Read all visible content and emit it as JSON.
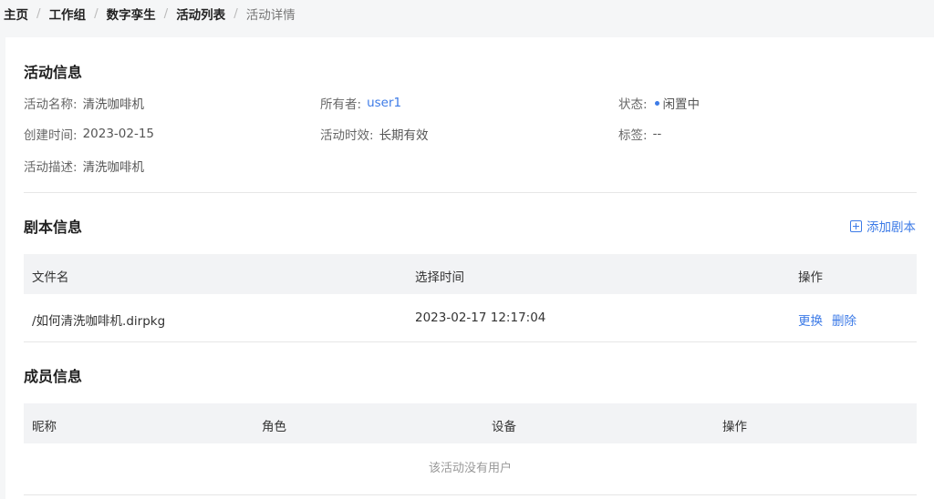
{
  "breadcrumb": [
    "主页",
    "工作组",
    "数字孪生",
    "活动列表",
    "活动详情"
  ],
  "activity_info": {
    "title": "活动信息",
    "name_label": "活动名称:",
    "name_value": "清洗咖啡机",
    "owner_label": "所有者:",
    "owner_value": "user1",
    "status_label": "状态:",
    "status_value": "闲置中",
    "created_label": "创建时间:",
    "created_value": "2023-02-15",
    "validity_label": "活动时效:",
    "validity_value": "长期有效",
    "tags_label": "标签:",
    "tags_value": "--",
    "desc_label": "活动描述:",
    "desc_value": "清洗咖啡机"
  },
  "script_info": {
    "title": "剧本信息",
    "add_label": "添加剧本",
    "columns": [
      "文件名",
      "选择时间",
      "操作"
    ],
    "rows": [
      {
        "file": "/如何清洗咖啡机.dirpkg",
        "time": "2023-02-17 12:17:04",
        "replace": "更换",
        "delete": "删除"
      }
    ]
  },
  "member_info": {
    "title": "成员信息",
    "columns": [
      "昵称",
      "角色",
      "设备",
      "操作"
    ],
    "empty_text": "该活动没有用户"
  },
  "colors": {
    "accent": "#3d7be7",
    "header_bg": "#f2f3f5",
    "page_bg": "#f5f6f7"
  }
}
